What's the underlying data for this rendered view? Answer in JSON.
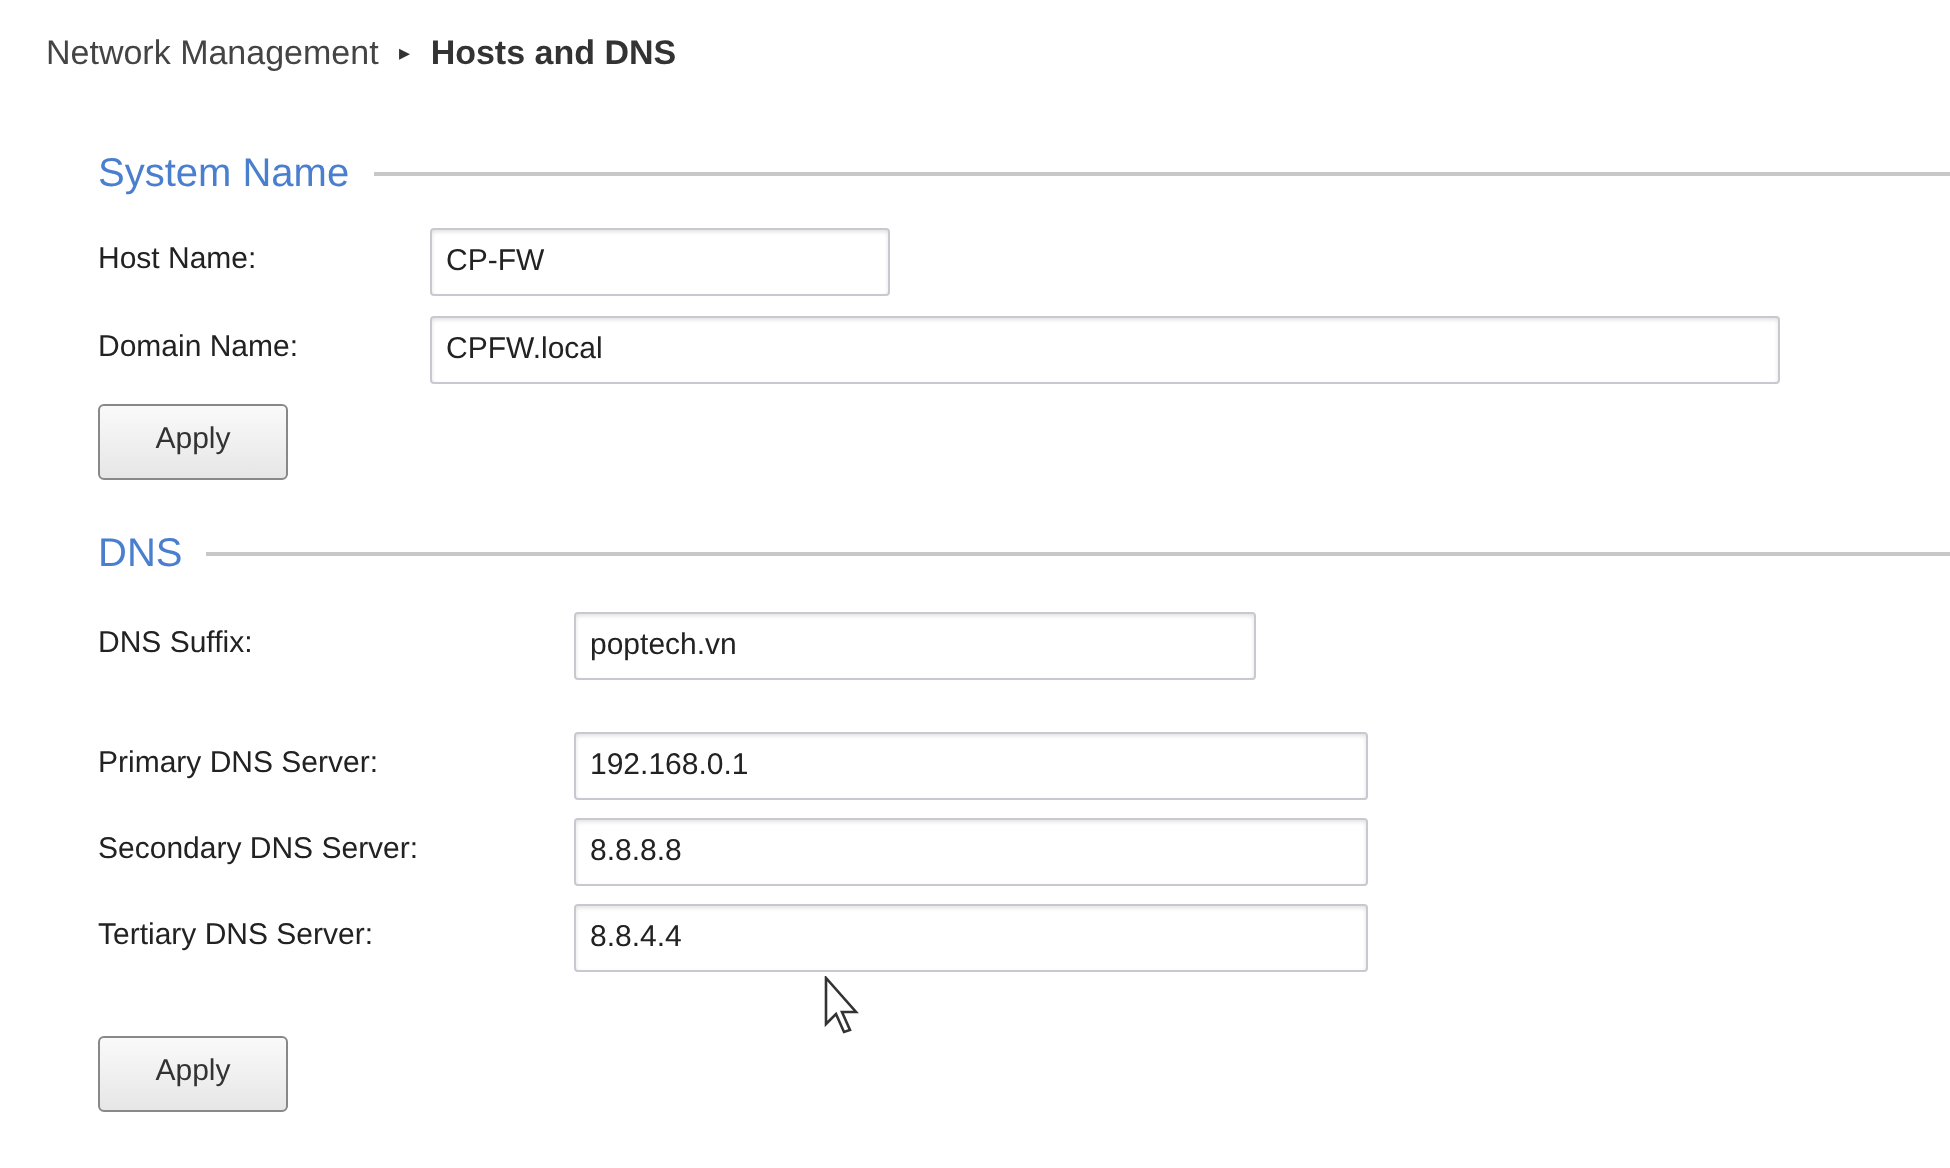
{
  "breadcrumb": {
    "parent": "Network Management",
    "separator": "▸",
    "current": "Hosts and DNS"
  },
  "sections": [
    {
      "title": "System Name",
      "fields": [
        {
          "label": "Host Name:",
          "value": "CP-FW"
        },
        {
          "label": "Domain Name:",
          "value": "CPFW.local"
        }
      ],
      "button": "Apply"
    },
    {
      "title": "DNS",
      "fields": [
        {
          "label": "DNS Suffix:",
          "value": "poptech.vn"
        }
      ],
      "groups": [
        [
          {
            "label": "Primary DNS Server:",
            "value": "192.168.0.1"
          },
          {
            "label": "Secondary DNS Server:",
            "value": "8.8.8.8"
          },
          {
            "label": "Tertiary DNS Server:",
            "value": "8.8.4.4"
          }
        ]
      ],
      "button": "Apply"
    }
  ]
}
